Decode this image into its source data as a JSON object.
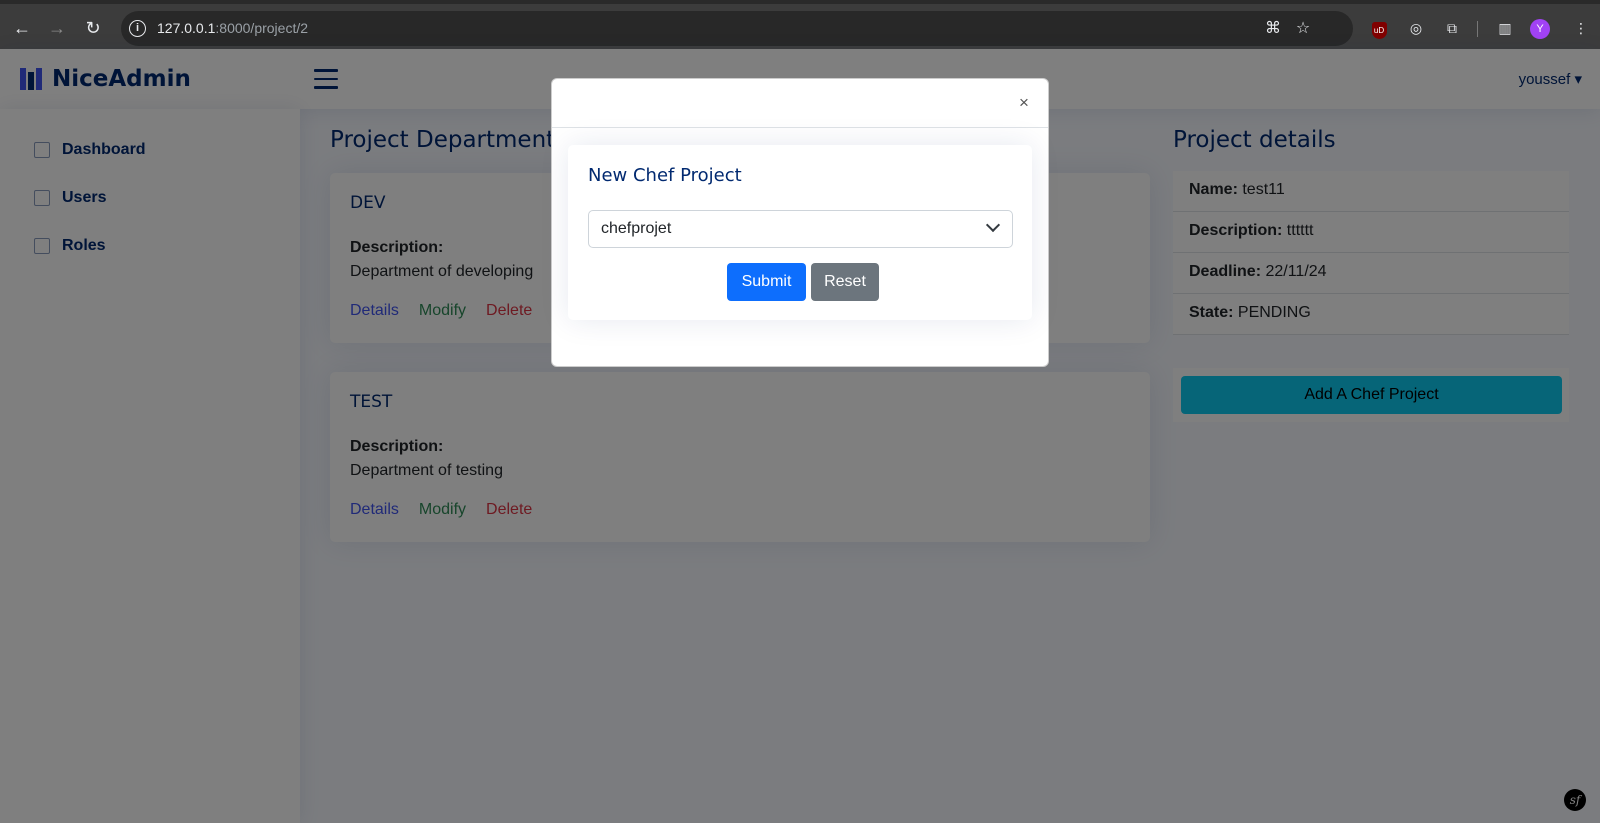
{
  "browser": {
    "url_host": "127.0.0.1",
    "url_rest": ":8000/project/2",
    "profile_initial": "Y",
    "ublock_label": "uD"
  },
  "app": {
    "logo_text": "NiceAdmin",
    "user_name": "youssef"
  },
  "sidebar": {
    "items": [
      {
        "label": "Dashboard",
        "icon": "grid-icon"
      },
      {
        "label": "Users",
        "icon": "list-icon"
      },
      {
        "label": "Roles",
        "icon": "document-icon"
      }
    ]
  },
  "main": {
    "title": "Project Departments",
    "departments": [
      {
        "name": "DEV",
        "description_label": "Description:",
        "description": "Department of developing",
        "actions": {
          "details": "Details",
          "modify": "Modify",
          "delete": "Delete"
        }
      },
      {
        "name": "TEST",
        "description_label": "Description:",
        "description": "Department of testing",
        "actions": {
          "details": "Details",
          "modify": "Modify",
          "delete": "Delete"
        }
      }
    ]
  },
  "details": {
    "title": "Project details",
    "rows": [
      {
        "label": "Name:",
        "value": "test11"
      },
      {
        "label": "Description:",
        "value": "tttttt"
      },
      {
        "label": "Deadline:",
        "value": "22/11/24"
      },
      {
        "label": "State:",
        "value": "PENDING"
      }
    ],
    "add_chef_label": "Add A Chef Project"
  },
  "modal": {
    "close_glyph": "×",
    "form_title": "New Chef Project",
    "select_value": "chefprojet",
    "submit_label": "Submit",
    "reset_label": "Reset"
  },
  "colors": {
    "brand": "#012970",
    "accent": "#4154f1",
    "submit": "#0d6efd",
    "reset": "#6c757d",
    "info": "#0dcaf0"
  }
}
